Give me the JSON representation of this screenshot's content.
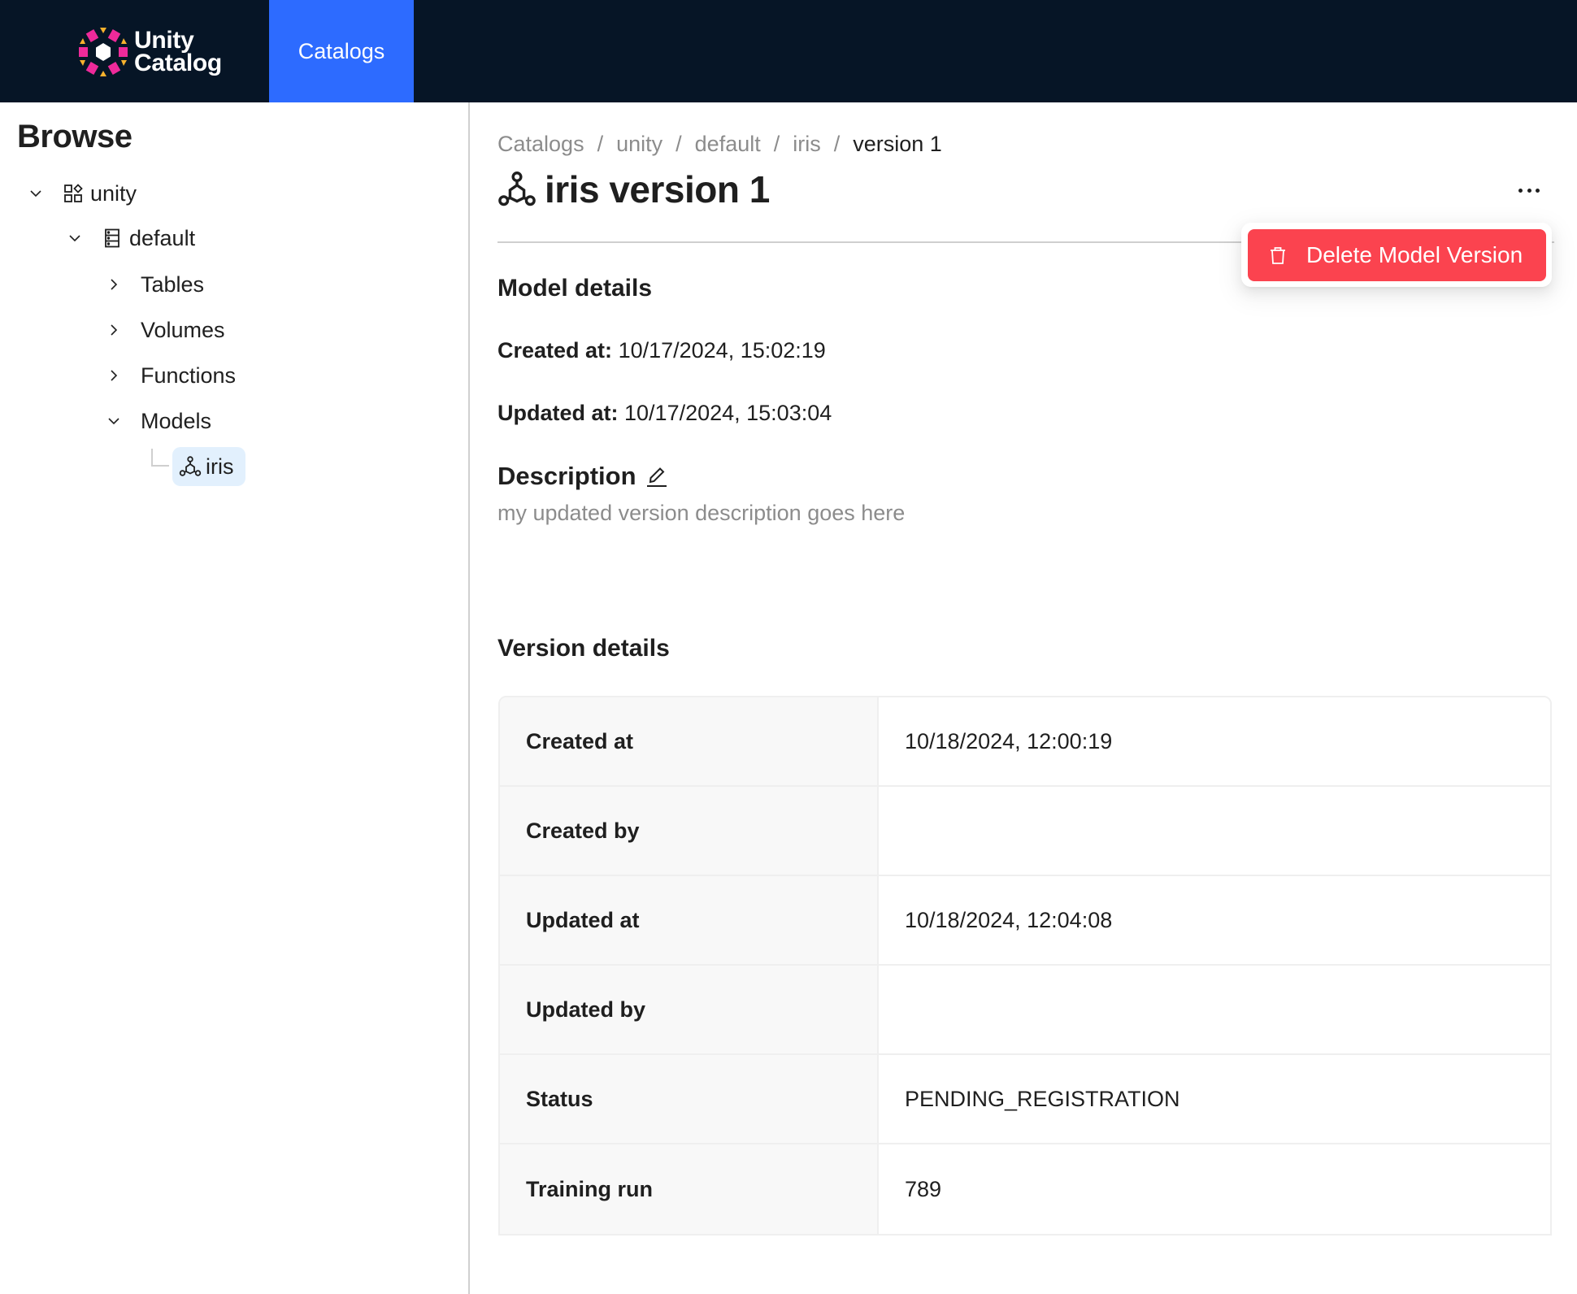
{
  "header": {
    "logo_line1": "Unity",
    "logo_line2": "Catalog",
    "logo_icon": "unity-catalog-logo-icon",
    "nav_tabs": [
      {
        "label": "Catalogs",
        "active": true
      }
    ],
    "colors": {
      "background": "#061526",
      "active_tab": "#2d6bff"
    }
  },
  "sidebar": {
    "title": "Browse",
    "tree": [
      {
        "label": "unity",
        "icon": "catalog-icon",
        "expanded": true,
        "level": 0
      },
      {
        "label": "default",
        "icon": "schema-icon",
        "expanded": true,
        "level": 1
      },
      {
        "label": "Tables",
        "expanded": false,
        "level": 2
      },
      {
        "label": "Volumes",
        "expanded": false,
        "level": 2
      },
      {
        "label": "Functions",
        "expanded": false,
        "level": 2
      },
      {
        "label": "Models",
        "expanded": true,
        "level": 2
      },
      {
        "label": "iris",
        "icon": "model-icon",
        "selected": true,
        "level": 3
      }
    ],
    "selected_color": "#e2f0fd"
  },
  "breadcrumb": [
    "Catalogs",
    "unity",
    "default",
    "iris",
    "version 1"
  ],
  "breadcrumb_separator": "/",
  "page": {
    "title": "iris version 1",
    "title_icon": "model-icon",
    "more_menu_icon": "ellipsis-icon"
  },
  "dropdown_menu": {
    "items": [
      {
        "label": "Delete Model Version",
        "icon": "trash-icon",
        "danger": true
      }
    ],
    "danger_color": "#fb434f"
  },
  "model_details": {
    "title": "Model details",
    "created_label": "Created at:",
    "created_value": "10/17/2024, 15:02:19",
    "updated_label": "Updated at:",
    "updated_value": "10/17/2024, 15:03:04"
  },
  "description": {
    "title": "Description",
    "edit_icon": "pencil-icon",
    "text": "my updated version description goes here"
  },
  "version_details": {
    "title": "Version details",
    "rows": [
      {
        "label": "Created at",
        "value": "10/18/2024, 12:00:19"
      },
      {
        "label": "Created by",
        "value": ""
      },
      {
        "label": "Updated at",
        "value": "10/18/2024, 12:04:08"
      },
      {
        "label": "Updated by",
        "value": ""
      },
      {
        "label": "Status",
        "value": "PENDING_REGISTRATION"
      },
      {
        "label": "Training run",
        "value": "789"
      }
    ]
  }
}
